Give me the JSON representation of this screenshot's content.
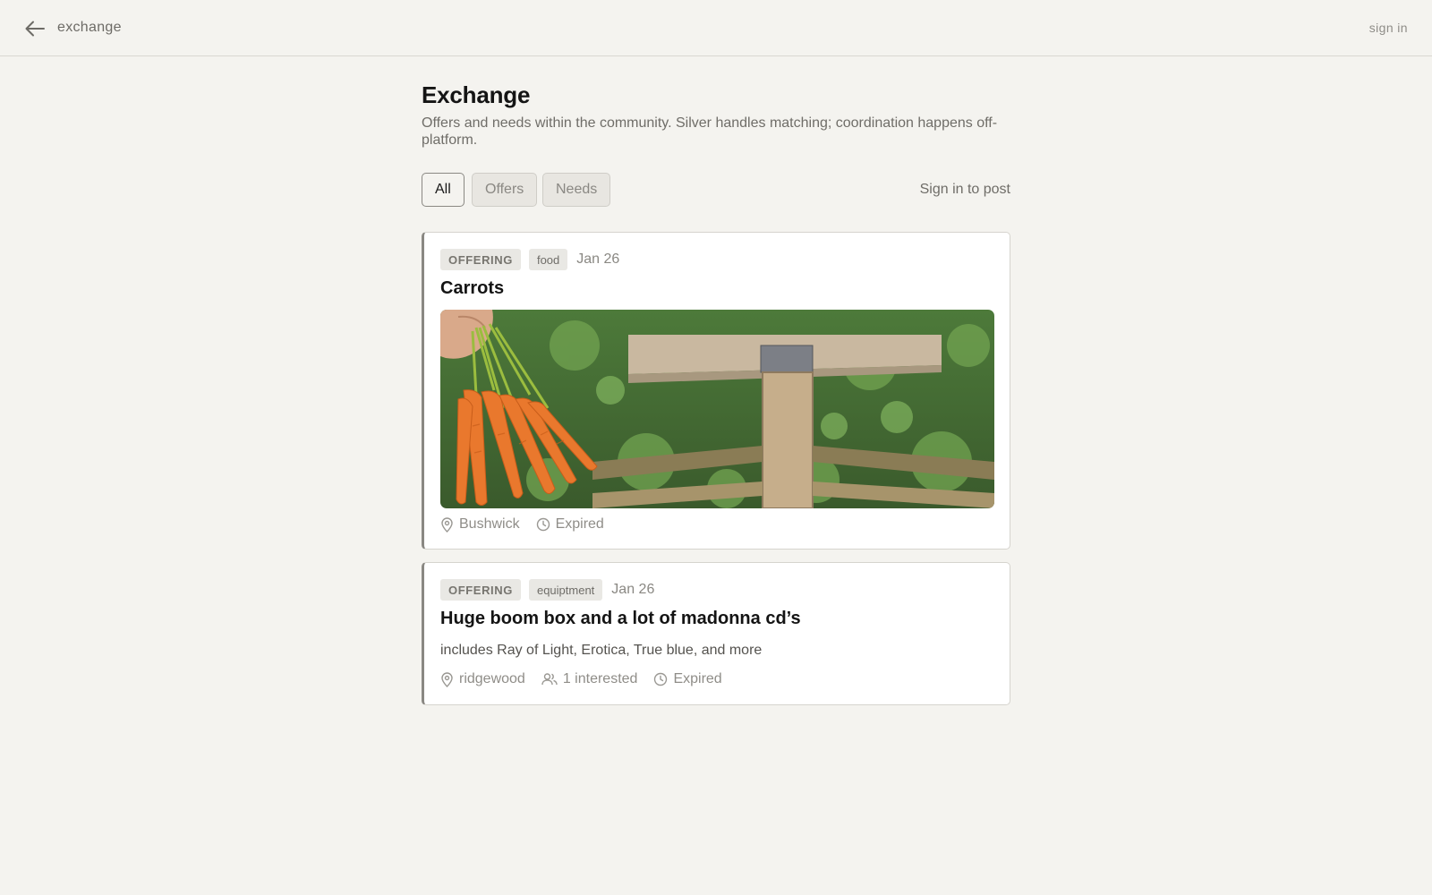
{
  "header": {
    "breadcrumb": "exchange",
    "sign_in_label": "sign in"
  },
  "page": {
    "title": "Exchange",
    "description": "Offers and needs within the community. Silver handles matching; coordination happens off-platform."
  },
  "filters": {
    "tabs": [
      {
        "label": "All",
        "active": true
      },
      {
        "label": "Offers",
        "active": false
      },
      {
        "label": "Needs",
        "active": false
      }
    ],
    "sign_in_to_post_label": "Sign in to post"
  },
  "listings": [
    {
      "kind": "OFFERING",
      "category": "food",
      "date": "Jan 26",
      "title": "Carrots",
      "has_image": true,
      "location": "Bushwick",
      "status": "Expired"
    },
    {
      "kind": "OFFERING",
      "category": "equiptment",
      "date": "Jan 26",
      "title": "Huge boom box and a lot of madonna cd’s",
      "description": "includes Ray of Light, Erotica, True blue, and more",
      "location": "ridgewood",
      "interested": "1 interested",
      "status": "Expired"
    }
  ],
  "icons": {
    "back": "arrow-left-icon",
    "location": "map-pin-icon",
    "people": "users-icon",
    "time": "clock-icon"
  },
  "colors": {
    "background": "#f4f3ef",
    "card": "#ffffff",
    "muted_text": "#8f8d88",
    "tag_bg": "#e9e8e4"
  }
}
